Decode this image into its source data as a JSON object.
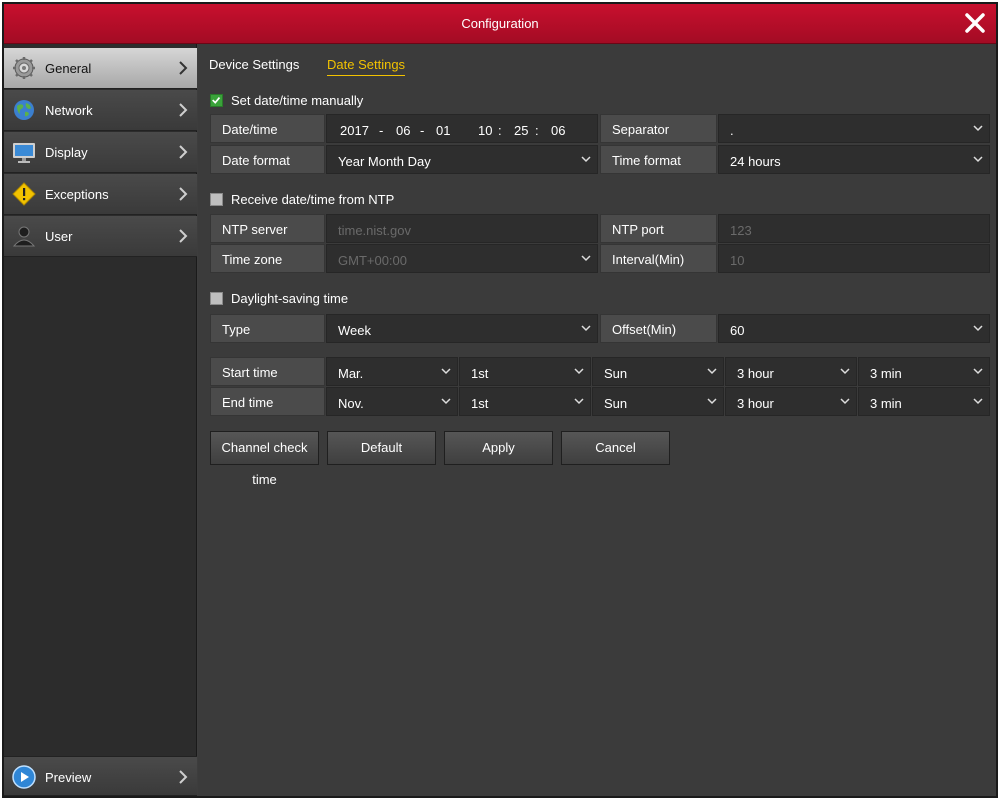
{
  "window": {
    "title": "Configuration"
  },
  "sidebar": {
    "items": [
      {
        "label": "General",
        "icon": "gear-icon"
      },
      {
        "label": "Network",
        "icon": "globe-icon"
      },
      {
        "label": "Display",
        "icon": "monitor-icon"
      },
      {
        "label": "Exceptions",
        "icon": "warning-icon"
      },
      {
        "label": "User",
        "icon": "user-icon"
      }
    ],
    "preview": {
      "label": "Preview",
      "icon": "play-icon"
    }
  },
  "tabs": [
    {
      "label": "Device Settings"
    },
    {
      "label": "Date Settings"
    }
  ],
  "manual": {
    "checkbox_label": "Set date/time manually",
    "checked": true,
    "datetime_label": "Date/time",
    "year": "2017",
    "month": "06",
    "day": "01",
    "hour": "10",
    "minute": "25",
    "second": "06",
    "dash": "-",
    "colon": ":",
    "separator_label": "Separator",
    "separator_value": ".",
    "date_format_label": "Date format",
    "date_format_value": "Year Month Day",
    "time_format_label": "Time format",
    "time_format_value": "24 hours"
  },
  "ntp": {
    "checkbox_label": "Receive date/time from NTP",
    "checked": false,
    "server_label": "NTP server",
    "server_value": "time.nist.gov",
    "port_label": "NTP port",
    "port_value": "123",
    "timezone_label": "Time zone",
    "timezone_value": "GMT+00:00",
    "interval_label": "Interval(Min)",
    "interval_value": "10"
  },
  "dst": {
    "checkbox_label": "Daylight-saving time",
    "checked": false,
    "type_label": "Type",
    "type_value": "Week",
    "offset_label": "Offset(Min)",
    "offset_value": "60",
    "start_label": "Start time",
    "start": {
      "month": "Mar.",
      "week": "1st",
      "day": "Sun",
      "hour": "3 hour",
      "min": "3 min"
    },
    "end_label": "End time",
    "end": {
      "month": "Nov.",
      "week": "1st",
      "day": "Sun",
      "hour": "3 hour",
      "min": "3 min"
    }
  },
  "buttons": {
    "channel_check": "Channel check time",
    "default": "Default",
    "apply": "Apply",
    "cancel": "Cancel"
  },
  "colors": {
    "title_bar": "#c8102e",
    "active_tab": "#f2c200",
    "checkbox_checked": "#3aa33a"
  }
}
